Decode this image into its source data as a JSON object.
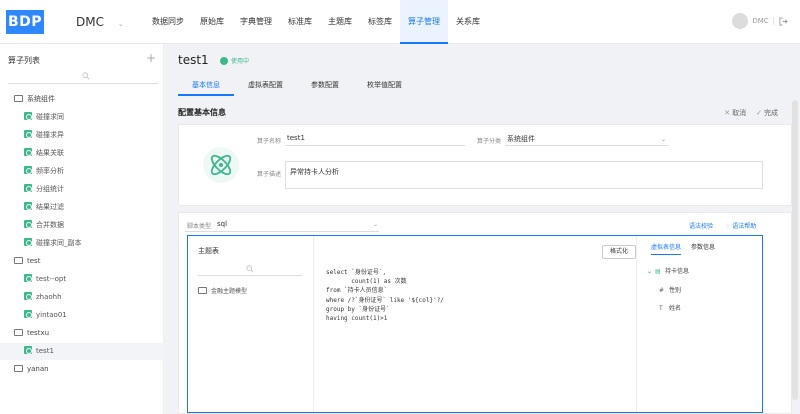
{
  "header": {
    "logo": "BDP",
    "app_name": "DMC",
    "app_chevron": "⌄",
    "nav": [
      {
        "label": "数据同步",
        "active": false
      },
      {
        "label": "原始库",
        "active": false
      },
      {
        "label": "字典管理",
        "active": false
      },
      {
        "label": "标准库",
        "active": false
      },
      {
        "label": "主题库",
        "active": false
      },
      {
        "label": "标签库",
        "active": false
      },
      {
        "label": "算子管理",
        "active": true
      },
      {
        "label": "关系库",
        "active": false
      }
    ],
    "user": "DMC",
    "logout_icon": "logout-icon"
  },
  "sidebar": {
    "title": "算子列表",
    "add": "+",
    "search_icon": "search-icon",
    "tree": [
      {
        "label": "系统组件",
        "type": "folder"
      },
      {
        "label": "碰撞求同",
        "type": "leaf"
      },
      {
        "label": "碰撞求异",
        "type": "leaf"
      },
      {
        "label": "结果关联",
        "type": "leaf"
      },
      {
        "label": "频率分析",
        "type": "leaf"
      },
      {
        "label": "分组统计",
        "type": "leaf"
      },
      {
        "label": "结果过滤",
        "type": "leaf"
      },
      {
        "label": "合并数据",
        "type": "leaf"
      },
      {
        "label": "碰撞求同_副本",
        "type": "leaf"
      },
      {
        "label": "test",
        "type": "folder"
      },
      {
        "label": "test--opt",
        "type": "leaf"
      },
      {
        "label": "zhaohh",
        "type": "leaf"
      },
      {
        "label": "yintao01",
        "type": "leaf"
      },
      {
        "label": "testxu",
        "type": "folder"
      },
      {
        "label": "test1",
        "type": "leaf",
        "selected": true
      },
      {
        "label": "yanan",
        "type": "folder"
      }
    ]
  },
  "main": {
    "title": "test1",
    "status": "使用中",
    "tabs": [
      {
        "label": "基本信息",
        "active": true
      },
      {
        "label": "虚拟表配置",
        "active": false
      },
      {
        "label": "参数配置",
        "active": false
      },
      {
        "label": "枚举值配置",
        "active": false
      }
    ],
    "section_title": "配置基本信息",
    "cancel": "取消",
    "done": "完成",
    "form": {
      "name_label": "算子名称",
      "name_value": "test1",
      "category_label": "算子分类",
      "category_value": "系统组件",
      "desc_label": "算子描述",
      "desc_value": "异常持卡人分析"
    },
    "script": {
      "type_label": "脚本类型",
      "type_value": "sql",
      "syntax_check": "语法校验",
      "syntax_help": "语法帮助",
      "table_title": "主题表",
      "table_item": "金融主题模型",
      "format_button": "格式化",
      "code_lines": [
        "select `身份证号`,",
        "       count(1) as 次数",
        "from `持卡人员信息`",
        "where /?`身份证号` like '${col}'?/",
        "group by `身份证号`",
        "having count(1)>1"
      ],
      "right_tabs": [
        {
          "label": "虚拟表信息",
          "active": true
        },
        {
          "label": "参数信息",
          "active": false
        }
      ],
      "tree_root": "持卡信息",
      "fields": [
        {
          "icon": "#",
          "label": "性别"
        },
        {
          "icon": "T",
          "label": "姓名"
        }
      ]
    }
  },
  "colors": {
    "primary": "#1677ff",
    "logo_bg": "#2f88ff",
    "green": "#3cb88a"
  }
}
